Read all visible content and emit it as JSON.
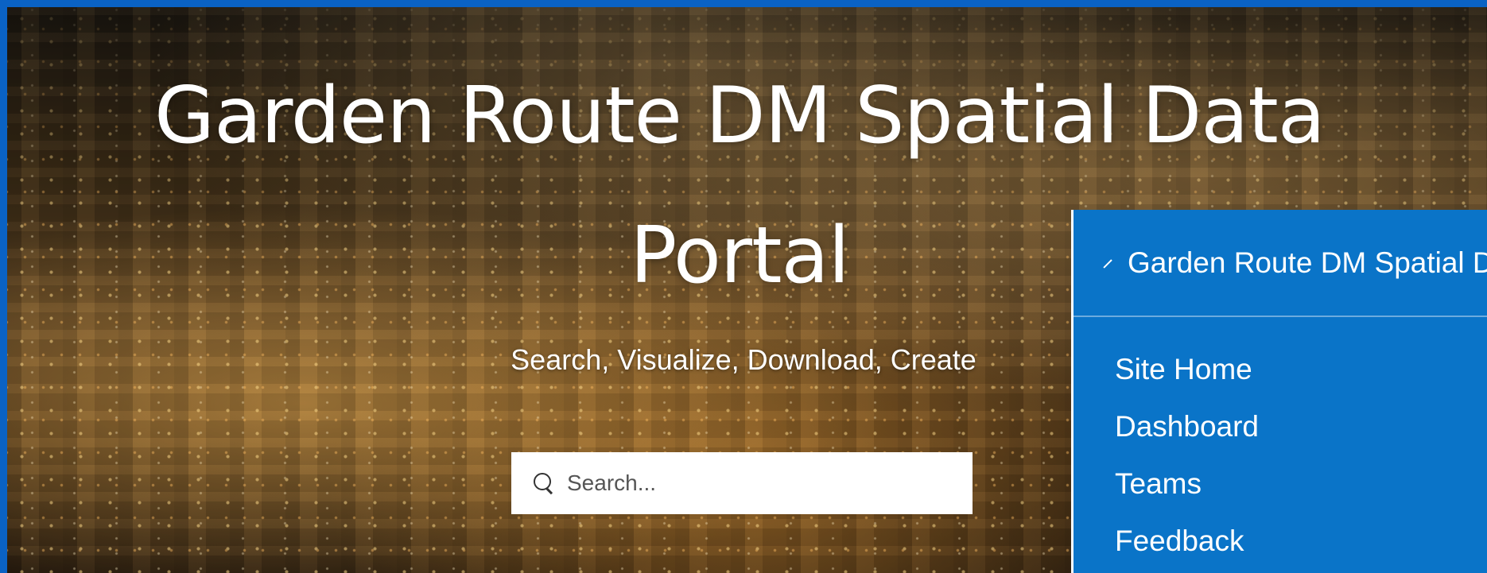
{
  "hero": {
    "title": "Garden Route DM Spatial Data Portal",
    "subtitle": "Search, Visualize, Download, Create",
    "search_placeholder": "Search..."
  },
  "nav_panel": {
    "header": "Garden Route DM Spatial Data Portal",
    "items": [
      {
        "label": "Site Home"
      },
      {
        "label": "Dashboard"
      },
      {
        "label": "Teams"
      },
      {
        "label": "Feedback"
      }
    ]
  },
  "colors": {
    "frame_blue": "#0a62c4",
    "panel_blue": "#0a74c8",
    "text": "#ffffff"
  },
  "icons": {
    "search": "magnifier",
    "header_chevron": "chevron-right"
  }
}
